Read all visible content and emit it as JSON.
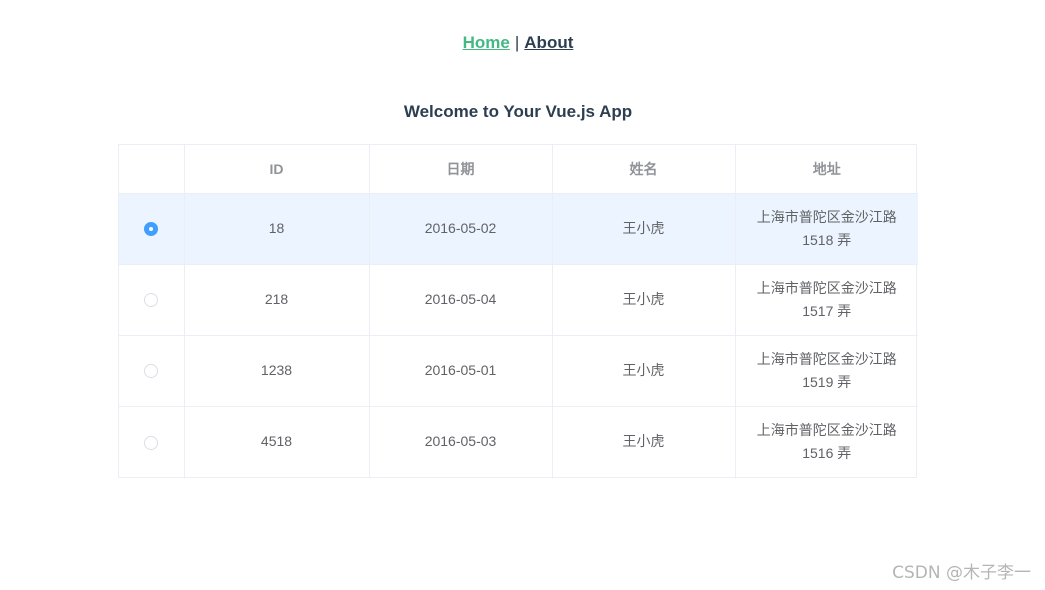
{
  "nav": {
    "home_label": "Home",
    "separator": "|",
    "about_label": "About"
  },
  "title": "Welcome to Your Vue.js App",
  "table": {
    "columns": [
      "",
      "ID",
      "日期",
      "姓名",
      "地址"
    ],
    "rows": [
      {
        "selected": true,
        "id": "18",
        "date": "2016-05-02",
        "name": "王小虎",
        "address": "上海市普陀区金沙江路 1518 弄"
      },
      {
        "selected": false,
        "id": "218",
        "date": "2016-05-04",
        "name": "王小虎",
        "address": "上海市普陀区金沙江路 1517 弄"
      },
      {
        "selected": false,
        "id": "1238",
        "date": "2016-05-01",
        "name": "王小虎",
        "address": "上海市普陀区金沙江路 1519 弄"
      },
      {
        "selected": false,
        "id": "4518",
        "date": "2016-05-03",
        "name": "王小虎",
        "address": "上海市普陀区金沙江路 1516 弄"
      }
    ]
  },
  "watermark": "CSDN @木子李一",
  "colors": {
    "accent": "#42b983",
    "text": "#2c3e50",
    "radio_checked": "#409eff",
    "selected_row_bg": "#ecf5ff"
  }
}
